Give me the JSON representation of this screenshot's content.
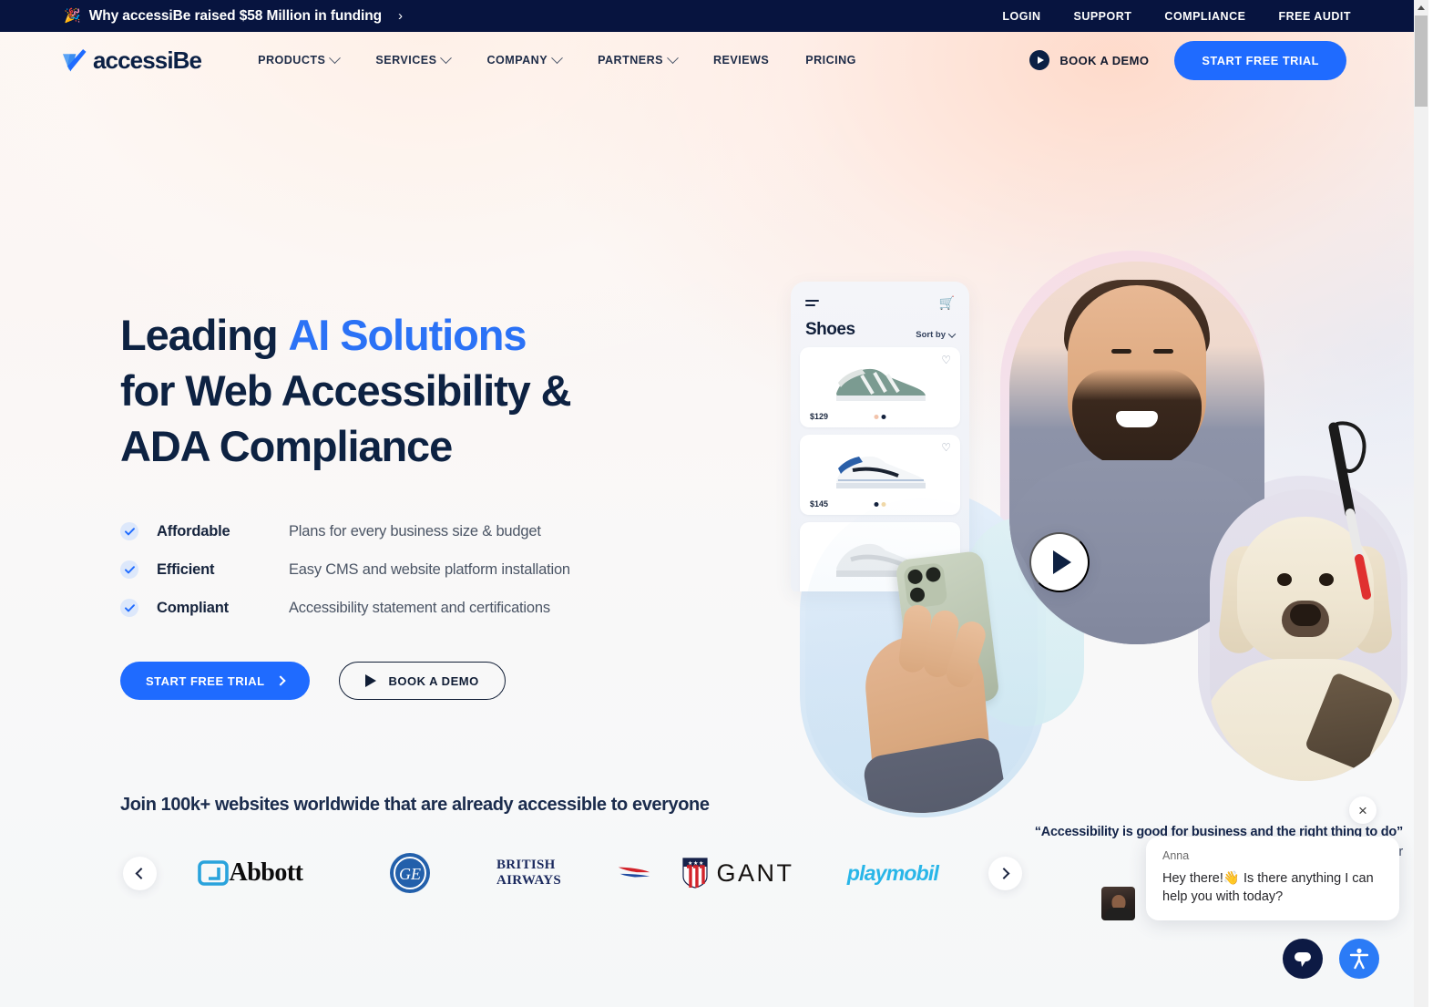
{
  "announcement": {
    "emoji": "🎉",
    "text": "Why accessiBe raised $58 Million in funding",
    "arrow": "›",
    "links": [
      "LOGIN",
      "SUPPORT",
      "COMPLIANCE",
      "FREE AUDIT"
    ]
  },
  "nav": {
    "logo_text": "accessiBe",
    "items": [
      {
        "label": "PRODUCTS",
        "has_dropdown": true
      },
      {
        "label": "SERVICES",
        "has_dropdown": true
      },
      {
        "label": "COMPANY",
        "has_dropdown": true
      },
      {
        "label": "PARTNERS",
        "has_dropdown": true
      },
      {
        "label": "REVIEWS",
        "has_dropdown": false
      },
      {
        "label": "PRICING",
        "has_dropdown": false
      }
    ],
    "book_demo": "BOOK A DEMO",
    "start_trial": "START FREE TRIAL"
  },
  "hero": {
    "headline_line1_a": "Leading ",
    "headline_line1_b": "AI Solutions",
    "headline_line2": "for Web Accessibility &",
    "headline_line3": "ADA Compliance",
    "bullets": [
      {
        "title": "Affordable",
        "desc": "Plans for every business size & budget"
      },
      {
        "title": "Efficient",
        "desc": "Easy CMS and website platform installation"
      },
      {
        "title": "Compliant",
        "desc": "Accessibility statement and certifications"
      }
    ],
    "cta_primary": "START FREE TRIAL",
    "cta_secondary": "BOOK A DEMO",
    "quote": "“Accessibility is good for business and the right thing to do”",
    "quote_author": "Ben, blind user & entrepreneur"
  },
  "phone_app": {
    "title": "Shoes",
    "sort_label": "Sort by",
    "products": [
      {
        "price": "$129",
        "swatches": [
          "#f2c3ab",
          "#14223e"
        ]
      },
      {
        "price": "$145",
        "swatches": [
          "#14223e",
          "#f0d8a8"
        ]
      },
      {
        "price": "",
        "swatches": []
      }
    ]
  },
  "logos": {
    "title": "Join 100k+ websites worldwide that are already accessible to everyone",
    "items": [
      {
        "name": "Abbott",
        "text": "Abbott"
      },
      {
        "name": "GE",
        "text": "GE"
      },
      {
        "name": "British Airways",
        "text": "BRITISH AIRWAYS"
      },
      {
        "name": "GANT",
        "text": "GANT"
      },
      {
        "name": "Playmobil",
        "text": "playmobil"
      }
    ],
    "prev_label": "‹",
    "next_label": "›"
  },
  "chat": {
    "close_label": "×",
    "agent_name": "Anna",
    "message": "Hey there!👋 Is there anything I can help you with today?"
  },
  "colors": {
    "brand_blue": "#1f6bff",
    "accent_blue": "#2b72f6",
    "navy": "#0b2045",
    "topbar_navy": "#07143f",
    "accessibility_blue": "#2b7bf6"
  }
}
